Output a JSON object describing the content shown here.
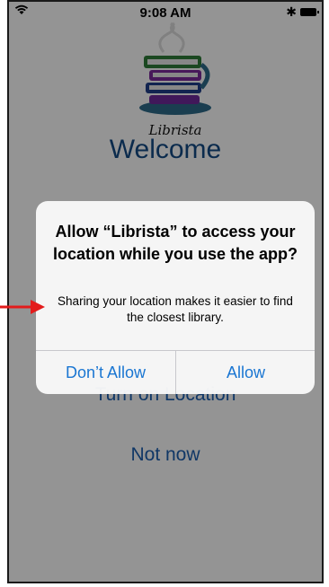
{
  "status_bar": {
    "time": "9:08 AM",
    "wifi_icon": "wifi-icon",
    "bluetooth_icon": "bluetooth-icon",
    "battery_icon": "battery-icon"
  },
  "app": {
    "logo_text": "Librista",
    "welcome": "Welcome",
    "turn_on_location": "Turn on Location",
    "not_now": "Not now"
  },
  "alert": {
    "title": "Allow “Librista” to access your location while you use the app?",
    "message": "Sharing your location makes it easier to find the closest library.",
    "dont_allow": "Don’t Allow",
    "allow": "Allow"
  },
  "colors": {
    "accent": "#1a76d2",
    "welcome": "#144a86",
    "annotation_arrow": "#e31b1b"
  }
}
